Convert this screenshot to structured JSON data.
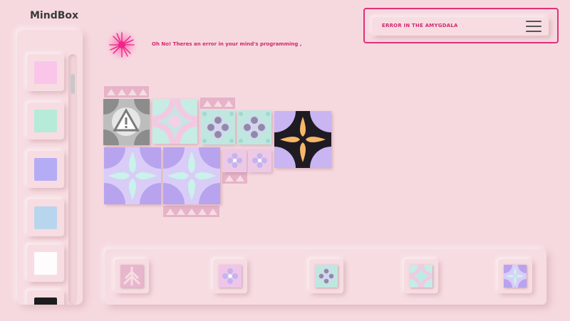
{
  "app": {
    "title": "MindBox"
  },
  "error": {
    "label": "ERROR IN THE AMYGDALA",
    "icon": "hamburger-menu-icon"
  },
  "message": {
    "text": "Oh No! Theres an error in your mind's programming ,",
    "icon": "neuron-burst-icon"
  },
  "palette": {
    "swatches": [
      {
        "color": "#f9c6ea"
      },
      {
        "color": "#b6ead9"
      },
      {
        "color": "#b5acf6"
      },
      {
        "color": "#b8d5ee"
      },
      {
        "color": "#fefcfd"
      },
      {
        "color": "#1c1c1e"
      }
    ],
    "scroll_position": 0.08
  },
  "tray": {
    "tiles": [
      "arrow-tile",
      "lavender-knot-tile",
      "mint-knot-tile",
      "mint-star-tile",
      "lavender-star-tile"
    ]
  },
  "colors": {
    "background": "#f6d9df",
    "accent": "#e0307a",
    "mint": "#bfeae3",
    "lavender": "#c7b6f5",
    "pink": "#e6b3c9"
  }
}
